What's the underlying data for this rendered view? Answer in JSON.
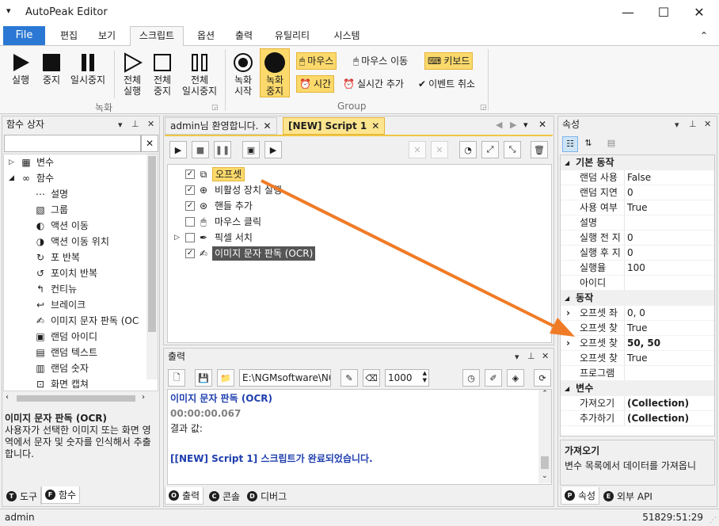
{
  "window": {
    "title": "AutoPeak Editor",
    "menu_icon": "▾",
    "minimize": "—",
    "maximize": "☐",
    "close": "✕"
  },
  "menu": {
    "file": "File",
    "items": [
      "편집",
      "보기",
      "스크립트",
      "옵션",
      "출력",
      "유틸리티",
      "시스템"
    ],
    "collapse": "⌃"
  },
  "ribbon": {
    "record_group_label": "녹화",
    "group_label": "Group",
    "run": "실행",
    "stop": "중지",
    "pause": "일시중지",
    "run_all": [
      "전체",
      "실행"
    ],
    "stop_all": [
      "전체",
      "중지"
    ],
    "pause_all": [
      "전체",
      "일시중지"
    ],
    "rec_start": [
      "녹화",
      "시작"
    ],
    "rec_stop": [
      "녹화",
      "중지"
    ],
    "mouse": "마우스",
    "mouse_move": "마우스 이동",
    "keyboard": "키보드",
    "time": "시간",
    "realtime_add": "실시간 추가",
    "event_cancel": "이벤트 취소"
  },
  "function_box": {
    "title": "함수 상자",
    "search_value": "",
    "tree": [
      {
        "label": "변수",
        "icon": "group-icon",
        "level": 0,
        "exp": "▷"
      },
      {
        "label": "함수",
        "icon": "infinity-icon",
        "level": 0,
        "exp": "◢"
      },
      {
        "label": "설명",
        "icon": "ellipsis-icon",
        "level": 1
      },
      {
        "label": "그룹",
        "icon": "cubes-icon",
        "level": 1
      },
      {
        "label": "액션 이동",
        "icon": "action-move-icon",
        "level": 1
      },
      {
        "label": "액션 이동 위치",
        "icon": "action-move-position-icon",
        "level": 1
      },
      {
        "label": "포 반복",
        "icon": "loop-icon",
        "level": 1
      },
      {
        "label": "포이치 반복",
        "icon": "foreach-icon",
        "level": 1
      },
      {
        "label": "컨티뉴",
        "icon": "continue-icon",
        "level": 1
      },
      {
        "label": "브레이크",
        "icon": "break-icon",
        "level": 1
      },
      {
        "label": "이미지 문자 판독 (OC",
        "icon": "ocr-icon",
        "level": 1
      },
      {
        "label": "랜덤 아이디",
        "icon": "random-id-icon",
        "level": 1
      },
      {
        "label": "랜덤 텍스트",
        "icon": "random-text-icon",
        "level": 1
      },
      {
        "label": "랜덤 숫자",
        "icon": "random-number-icon",
        "level": 1
      },
      {
        "label": "화면 캡쳐",
        "icon": "screen-capture-icon",
        "level": 1
      }
    ],
    "desc_title": "이미지 문자 판독 (OCR)",
    "desc_text": "사용자가 선택한 이미지 또는 화면 영역에서 문자 및 숫자를 인식해서 추출합니다.",
    "tabs": [
      {
        "letter": "T",
        "label": "도구"
      },
      {
        "letter": "F",
        "label": "함수"
      }
    ]
  },
  "editor": {
    "tabs": [
      "admin님 환영합니다.",
      "[NEW] Script 1"
    ],
    "items": [
      {
        "label": "오프셋",
        "checked": true,
        "icon": "offset-icon",
        "hl": "yellow"
      },
      {
        "label": "비활성 장치 실행",
        "checked": true,
        "icon": "crosshair-icon"
      },
      {
        "label": "핸들 추가",
        "checked": true,
        "icon": "handle-target-icon"
      },
      {
        "label": "마우스 클릭",
        "checked": false,
        "icon": "mouse-click-icon"
      },
      {
        "label": "픽셀 서치",
        "checked": false,
        "icon": "eyedropper-icon",
        "exp": "▷"
      },
      {
        "label": "이미지 문자 판독 (OCR)",
        "checked": true,
        "icon": "ocr-icon",
        "hl": "dark"
      }
    ]
  },
  "output": {
    "title": "출력",
    "path": "E:\\NGMsoftware\\NG",
    "count": "1000",
    "lines": [
      {
        "text": "이미지 문자 판독 (OCR)",
        "color": "#1f3fae",
        "bold": true
      },
      {
        "text": "00:00:00.067",
        "color": "#808080",
        "bold": true
      },
      {
        "text": "결과 값:",
        "color": "#1e1e1e",
        "bold": false
      },
      {
        "text": "",
        "color": "#1e1e1e",
        "bold": false
      },
      {
        "text": "[[NEW] Script 1] 스크립트가 완료되었습니다.",
        "color": "#1f3fae",
        "bold": true
      }
    ],
    "tabs": [
      {
        "letter": "O",
        "label": "출력"
      },
      {
        "letter": "C",
        "label": "콘솔"
      },
      {
        "letter": "D",
        "label": "디버그"
      }
    ]
  },
  "properties": {
    "title": "속성",
    "rows": [
      {
        "cat": "기본 동작",
        "exp": "◢"
      },
      {
        "name": "랜덤 사용",
        "value": "False"
      },
      {
        "name": "랜덤 지연",
        "value": "0"
      },
      {
        "name": "사용 여부",
        "value": "True"
      },
      {
        "name": "설명",
        "value": ""
      },
      {
        "name": "실행 전 지",
        "value": "0"
      },
      {
        "name": "실행 후 지",
        "value": "0"
      },
      {
        "name": "실행율",
        "value": "100"
      },
      {
        "name": "아이디",
        "value": ""
      },
      {
        "cat": "동작",
        "exp": "◢"
      },
      {
        "name": "오프셋 좌",
        "value": "0, 0",
        "exp": "›"
      },
      {
        "name": "오프셋 찾",
        "value": "True"
      },
      {
        "name": "오프셋 찾",
        "value": "50, 50",
        "exp": "›",
        "bold": true
      },
      {
        "name": "오프셋 찾",
        "value": "True"
      },
      {
        "name": "프로그램",
        "value": ""
      },
      {
        "cat": "변수",
        "exp": "◢"
      },
      {
        "name": "가져오기",
        "value": "(Collection)",
        "bold": true
      },
      {
        "name": "추가하기",
        "value": "(Collection)",
        "bold": true
      }
    ],
    "desc_title": "가져오기",
    "desc_text": "변수 목록에서 데이터를 가져옵니다.",
    "desc_text_visible": "변수 목록에서 데이터를 가져옵니",
    "tabs": [
      {
        "letter": "P",
        "label": "속성"
      },
      {
        "letter": "E",
        "label": "외부 API"
      }
    ]
  },
  "status": {
    "user": "admin",
    "time": "51829:51:29"
  },
  "colors": {
    "accent": "#2b78d4",
    "highlight": "#fbd96b",
    "arrow": "#f07b26"
  }
}
